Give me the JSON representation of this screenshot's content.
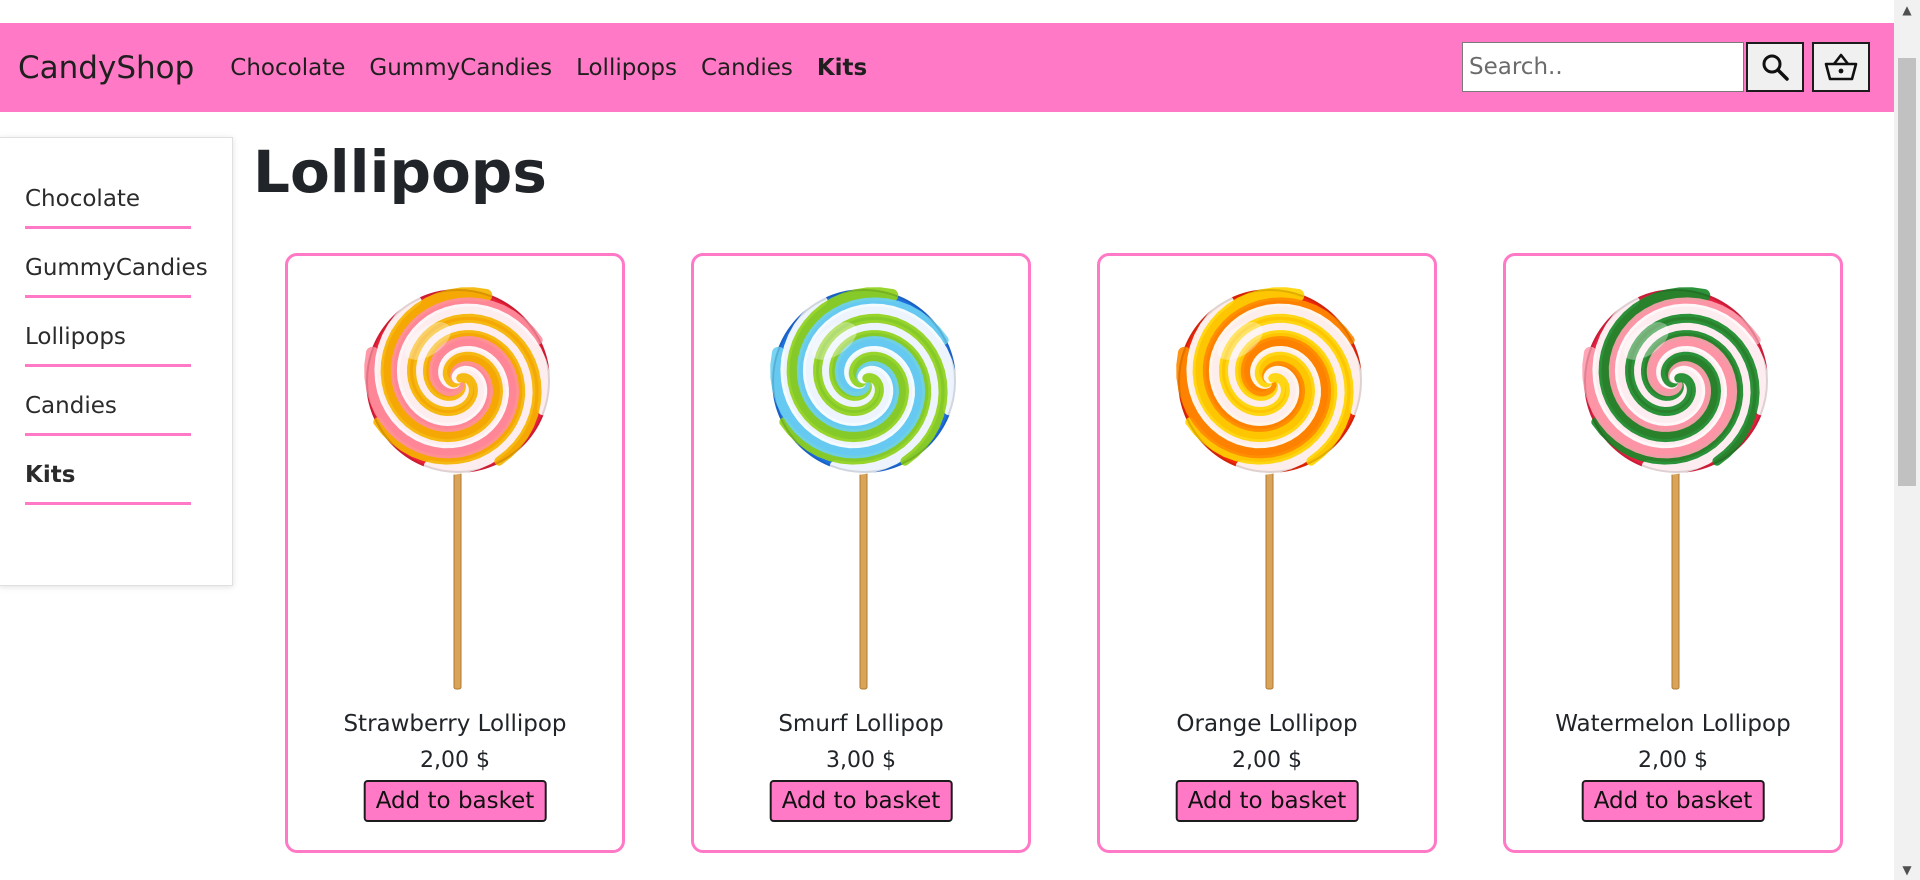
{
  "brand": "CandyShop",
  "colors": {
    "accent": "#ff79c6",
    "text": "#212529",
    "border": "#1c1c1c"
  },
  "nav": {
    "links": [
      "Chocolate",
      "GummyCandies",
      "Lollipops",
      "Candies",
      "Kits"
    ],
    "active": "Kits"
  },
  "search": {
    "placeholder": "Search..",
    "value": "",
    "icon": "search-icon"
  },
  "basket": {
    "icon": "basket-icon"
  },
  "sidebar": {
    "items": [
      "Chocolate",
      "GummyCandies",
      "Lollipops",
      "Candies",
      "Kits"
    ],
    "active": "Kits"
  },
  "page": {
    "title": "Lollipops"
  },
  "products": [
    {
      "name": "Strawberry Lollipop",
      "price": "2,00 $",
      "button": "Add to basket",
      "swirl_colors": [
        "#e8203a",
        "#ffffff",
        "#f5b400",
        "#ff8fa0"
      ]
    },
    {
      "name": "Smurf Lollipop",
      "price": "3,00 $",
      "button": "Add to basket",
      "swirl_colors": [
        "#1e6fe0",
        "#ffffff",
        "#8fd11a",
        "#6cd0f2"
      ]
    },
    {
      "name": "Orange Lollipop",
      "price": "2,00 $",
      "button": "Add to basket",
      "swirl_colors": [
        "#f0280c",
        "#ffffff",
        "#ffd400",
        "#ff8a00"
      ]
    },
    {
      "name": "Watermelon Lollipop",
      "price": "2,00 $",
      "button": "Add to basket",
      "swirl_colors": [
        "#e52040",
        "#ffffff",
        "#1a8a2a",
        "#ff9fb0"
      ]
    }
  ]
}
